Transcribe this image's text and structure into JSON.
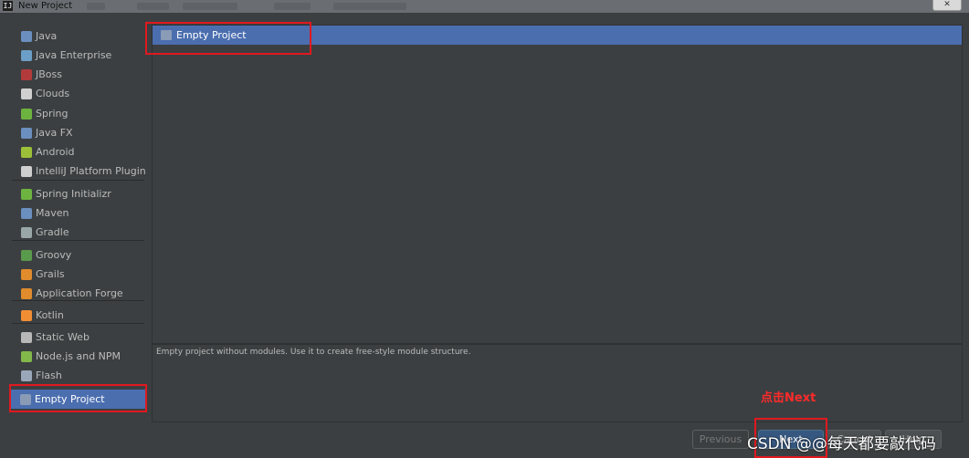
{
  "window": {
    "title": "New Project",
    "close_label": "✕"
  },
  "sidebar": {
    "items": [
      {
        "label": "Java",
        "icon": "java-folder-icon",
        "color": "#6b8fbf"
      },
      {
        "label": "Java Enterprise",
        "icon": "java-enterprise-icon",
        "color": "#6b9fc8"
      },
      {
        "label": "JBoss",
        "icon": "jboss-icon",
        "color": "#b33a3a"
      },
      {
        "label": "Clouds",
        "icon": "clouds-icon",
        "color": "#d0d0d0"
      },
      {
        "label": "Spring",
        "icon": "spring-leaf-icon",
        "color": "#6db33f"
      },
      {
        "label": "Java FX",
        "icon": "javafx-folder-icon",
        "color": "#6b8fbf"
      },
      {
        "label": "Android",
        "icon": "android-icon",
        "color": "#9cc139"
      },
      {
        "label": "IntelliJ Platform Plugin",
        "icon": "plugin-icon",
        "color": "#cfcfcf"
      },
      {
        "label": "Spring Initializr",
        "icon": "spring-initializr-icon",
        "color": "#6db33f"
      },
      {
        "label": "Maven",
        "icon": "maven-icon",
        "color": "#6b8fbf"
      },
      {
        "label": "Gradle",
        "icon": "gradle-icon",
        "color": "#9aa7a8"
      },
      {
        "label": "Groovy",
        "icon": "groovy-icon",
        "color": "#5a9a4c"
      },
      {
        "label": "Grails",
        "icon": "grails-icon",
        "color": "#e08b2c"
      },
      {
        "label": "Application Forge",
        "icon": "application-forge-icon",
        "color": "#e08b2c"
      },
      {
        "label": "Kotlin",
        "icon": "kotlin-icon",
        "color": "#f18e33"
      },
      {
        "label": "Static Web",
        "icon": "static-web-icon",
        "color": "#b8b8b8"
      },
      {
        "label": "Node.js and NPM",
        "icon": "nodejs-icon",
        "color": "#83b84a"
      },
      {
        "label": "Flash",
        "icon": "flash-icon",
        "color": "#9aa7b8"
      },
      {
        "label": "Empty Project",
        "icon": "empty-project-folder-icon",
        "color": "#8a9bb5"
      }
    ]
  },
  "templates": [
    {
      "label": "Empty Project",
      "icon": "folder-icon"
    }
  ],
  "description": "Empty project without modules. Use it to create free-style module structure.",
  "annotation": "点击Next",
  "buttons": {
    "previous": "Previous",
    "next": "Next",
    "cancel": "Cancel",
    "help": "Help"
  },
  "watermark": "CSDN @@每天都要敲代码",
  "colors": {
    "selection": "#4b6eaf",
    "highlight": "#e0191f",
    "background": "#3c3f41"
  }
}
